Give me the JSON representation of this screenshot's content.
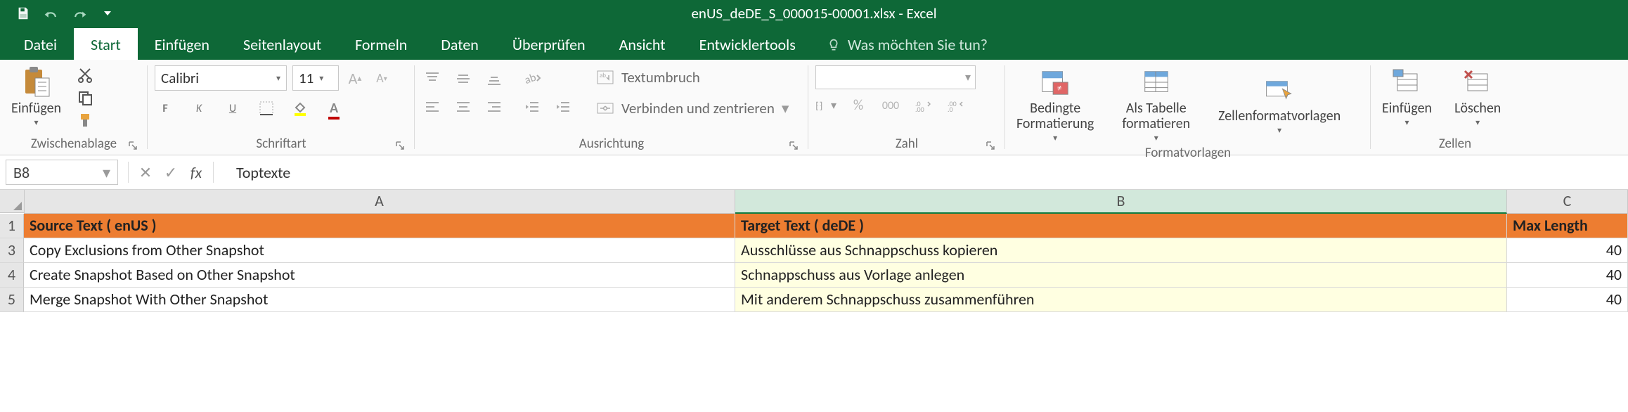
{
  "app": {
    "title": "enUS_deDE_S_000015-00001.xlsx - Excel"
  },
  "tabs": {
    "file": "Datei",
    "home": "Start",
    "insert": "Einfügen",
    "pagelayout": "Seitenlayout",
    "formulas": "Formeln",
    "data": "Daten",
    "review": "Überprüfen",
    "view": "Ansicht",
    "developer": "Entwicklertools",
    "tellme": "Was möchten Sie tun?"
  },
  "ribbon": {
    "clipboard": {
      "label": "Zwischenablage",
      "paste": "Einfügen"
    },
    "font": {
      "label": "Schriftart",
      "name": "Calibri",
      "size": "11",
      "bold": "F",
      "italic": "K",
      "underline": "U"
    },
    "alignment": {
      "label": "Ausrichtung",
      "wrap": "Textumbruch",
      "merge": "Verbinden und zentrieren"
    },
    "number": {
      "label": "Zahl",
      "percent": "%",
      "thousands": "000"
    },
    "styles": {
      "label": "Formatvorlagen",
      "cond": "Bedingte\nFormatierung",
      "table": "Als Tabelle\nformatieren",
      "cellstyles": "Zellenformatvorlagen"
    },
    "cells": {
      "label": "Zellen",
      "insert": "Einfügen",
      "delete": "Löschen"
    }
  },
  "formulaBar": {
    "name": "B8",
    "formula": "Toptexte"
  },
  "columns": {
    "A": "A",
    "B": "B",
    "C": "C"
  },
  "headerRow": {
    "rownum": "1",
    "A": "Source Text ( enUS )",
    "B": "Target Text ( deDE )",
    "C": "Max Length"
  },
  "rows": [
    {
      "rownum": "3",
      "A": "Copy Exclusions from Other Snapshot",
      "B": "Ausschlüsse aus Schnappschuss kopieren",
      "C": "40"
    },
    {
      "rownum": "4",
      "A": "Create Snapshot Based on Other Snapshot",
      "B": "Schnappschuss aus Vorlage anlegen",
      "C": "40"
    },
    {
      "rownum": "5",
      "A": "Merge Snapshot With Other Snapshot",
      "B": "Mit anderem Schnappschuss zusammenführen",
      "C": "40"
    }
  ]
}
